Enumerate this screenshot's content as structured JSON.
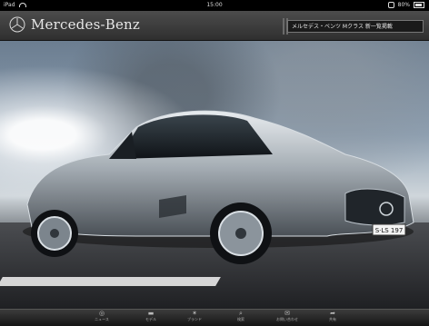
{
  "status_bar": {
    "device": "iPad",
    "time": "15:00",
    "battery": "80%"
  },
  "header": {
    "brand": "Mercedes-Benz",
    "search_value": "メルセデス・ベンツ Mクラス 新一覧掲載"
  },
  "hero": {
    "license_plate": "S·LS 197"
  },
  "tabs": [
    {
      "label": "ニュース"
    },
    {
      "label": "モデル"
    },
    {
      "label": "ブランド"
    },
    {
      "label": "検索"
    },
    {
      "label": "お問い合わせ"
    },
    {
      "label": "共有"
    }
  ]
}
